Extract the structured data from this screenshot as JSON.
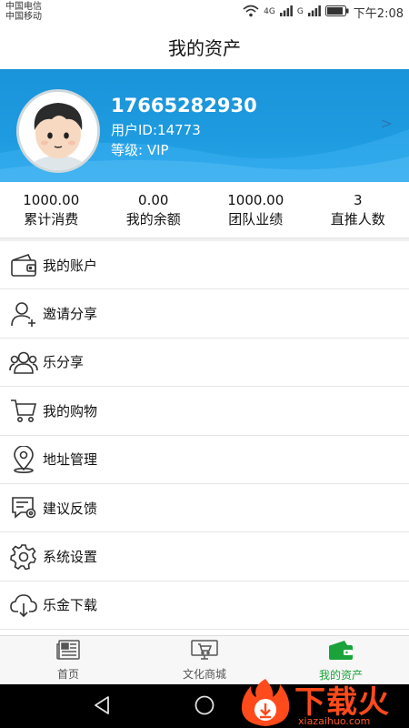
{
  "status_bar": {
    "carrier1": "中国电信",
    "carrier2": "中国移动",
    "net1": "4G",
    "net2": "G",
    "time": "下午2:08"
  },
  "header": {
    "title": "我的资产"
  },
  "profile": {
    "phone": "17665282930",
    "user_id": "用户ID:14773",
    "level": "等级:  VIP",
    "chevron": ">"
  },
  "stats": [
    {
      "value": "1000.00",
      "label": "累计消费"
    },
    {
      "value": "0.00",
      "label": "我的余额"
    },
    {
      "value": "1000.00",
      "label": "团队业绩"
    },
    {
      "value": "3",
      "label": "直推人数"
    }
  ],
  "menu": [
    {
      "label": "我的账户",
      "icon": "wallet-icon"
    },
    {
      "label": "邀请分享",
      "icon": "add-user-icon"
    },
    {
      "label": "乐分享",
      "icon": "group-icon"
    },
    {
      "label": "我的购物",
      "icon": "cart-icon"
    },
    {
      "label": "地址管理",
      "icon": "location-icon"
    },
    {
      "label": "建议反馈",
      "icon": "feedback-icon"
    },
    {
      "label": "系统设置",
      "icon": "gear-icon"
    },
    {
      "label": "乐金下载",
      "icon": "cloud-download-icon"
    }
  ],
  "tabs": [
    {
      "label": "首页",
      "icon": "newspaper-icon"
    },
    {
      "label": "文化商城",
      "icon": "shop-icon"
    },
    {
      "label": "我的资产",
      "icon": "wallet-icon"
    }
  ],
  "colors": {
    "banner": "#1e9be0",
    "active_tab": "#1aa33a",
    "watermark": "#ff4a1c"
  },
  "watermark": {
    "text": "下载火",
    "sub": "xiazaihuo.com"
  }
}
